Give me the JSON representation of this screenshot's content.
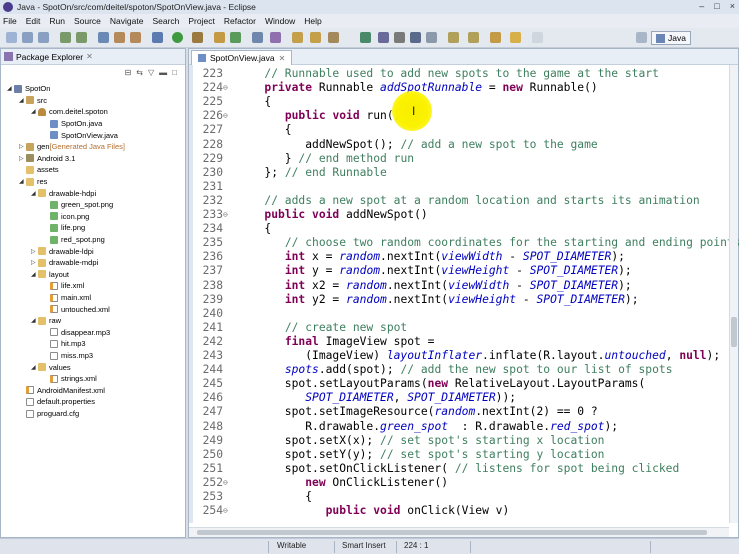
{
  "window": {
    "title": "Java - SpotOn/src/com/deitel/spoton/SpotOnView.java - Eclipse",
    "controls": [
      "–",
      "□",
      "×"
    ]
  },
  "menu": [
    "File",
    "Edit",
    "Run",
    "Source",
    "Navigate",
    "Search",
    "Project",
    "Refactor",
    "Window",
    "Help"
  ],
  "toolbar": {
    "perspective_label": "Java"
  },
  "package_explorer": {
    "title": "Package Explorer",
    "tree": [
      {
        "label": "SpotOn",
        "icon": "project",
        "indent": 1,
        "expanded": true
      },
      {
        "label": "src",
        "icon": "src-folder",
        "indent": 2,
        "expanded": true
      },
      {
        "label": "com.deitel.spoton",
        "icon": "package",
        "indent": 3,
        "expanded": true
      },
      {
        "label": "SpotOn.java",
        "icon": "java-file",
        "indent": 4
      },
      {
        "label": "SpotOnView.java",
        "icon": "java-file",
        "indent": 4
      },
      {
        "label": "gen",
        "extra": "[Generated Java Files]",
        "icon": "src-folder",
        "indent": 2,
        "expanded": false
      },
      {
        "label": "Android 3.1",
        "icon": "library",
        "indent": 2,
        "expanded": false
      },
      {
        "label": "assets",
        "icon": "folder",
        "indent": 2
      },
      {
        "label": "res",
        "icon": "folder",
        "indent": 2,
        "expanded": true
      },
      {
        "label": "drawable-hdpi",
        "icon": "folder",
        "indent": 3,
        "expanded": true
      },
      {
        "label": "green_spot.png",
        "icon": "image-file",
        "indent": 4
      },
      {
        "label": "icon.png",
        "icon": "image-file",
        "indent": 4
      },
      {
        "label": "life.png",
        "icon": "image-file",
        "indent": 4
      },
      {
        "label": "red_spot.png",
        "icon": "image-file",
        "indent": 4
      },
      {
        "label": "drawable-ldpi",
        "icon": "folder",
        "indent": 3,
        "expanded": false
      },
      {
        "label": "drawable-mdpi",
        "icon": "folder",
        "indent": 3,
        "expanded": false
      },
      {
        "label": "layout",
        "icon": "folder",
        "indent": 3,
        "expanded": true
      },
      {
        "label": "life.xml",
        "icon": "xml-file",
        "indent": 4
      },
      {
        "label": "main.xml",
        "icon": "xml-file",
        "indent": 4
      },
      {
        "label": "untouched.xml",
        "icon": "xml-file",
        "indent": 4
      },
      {
        "label": "raw",
        "icon": "folder",
        "indent": 3,
        "expanded": true
      },
      {
        "label": "disappear.mp3",
        "icon": "file",
        "indent": 4
      },
      {
        "label": "hit.mp3",
        "icon": "file",
        "indent": 4
      },
      {
        "label": "miss.mp3",
        "icon": "file",
        "indent": 4
      },
      {
        "label": "values",
        "icon": "folder",
        "indent": 3,
        "expanded": true
      },
      {
        "label": "strings.xml",
        "icon": "xml-file",
        "indent": 4
      },
      {
        "label": "AndroidManifest.xml",
        "icon": "xml-file",
        "indent": 2
      },
      {
        "label": "default.properties",
        "icon": "file",
        "indent": 2
      },
      {
        "label": "proguard.cfg",
        "icon": "file",
        "indent": 2
      }
    ]
  },
  "editor": {
    "tab_label": "SpotOnView.java",
    "lines": [
      {
        "n": "223",
        "fold": "",
        "tokens": [
          [
            "   ",
            ""
          ],
          [
            "// Runnable used to add new spots to the game at the start",
            "cm"
          ]
        ]
      },
      {
        "n": "224",
        "fold": "⊖",
        "tokens": [
          [
            "   ",
            ""
          ],
          [
            "private",
            "kw"
          ],
          [
            " Runnable ",
            ""
          ],
          [
            "addSpotRunnable",
            "fld"
          ],
          [
            " = ",
            ""
          ],
          [
            "new",
            "kw"
          ],
          [
            " Runnable()",
            ""
          ]
        ]
      },
      {
        "n": "225",
        "fold": "",
        "tokens": [
          [
            "   {",
            ""
          ]
        ]
      },
      {
        "n": "226",
        "fold": "⊖",
        "tokens": [
          [
            "      ",
            ""
          ],
          [
            "public",
            "kw"
          ],
          [
            " ",
            ""
          ],
          [
            "void",
            "kw"
          ],
          [
            " run()",
            ""
          ]
        ]
      },
      {
        "n": "227",
        "fold": "",
        "tokens": [
          [
            "      {",
            ""
          ]
        ]
      },
      {
        "n": "228",
        "fold": "",
        "tokens": [
          [
            "         addNewSpot(); ",
            ""
          ],
          [
            "// add a new spot to the game",
            "cm"
          ]
        ]
      },
      {
        "n": "229",
        "fold": "",
        "tokens": [
          [
            "      } ",
            ""
          ],
          [
            "// end method run",
            "cm"
          ]
        ]
      },
      {
        "n": "230",
        "fold": "",
        "tokens": [
          [
            "   }; ",
            ""
          ],
          [
            "// end Runnable",
            "cm"
          ]
        ]
      },
      {
        "n": "231",
        "fold": "",
        "tokens": [
          [
            "",
            ""
          ]
        ]
      },
      {
        "n": "232",
        "fold": "",
        "tokens": [
          [
            "   ",
            ""
          ],
          [
            "// adds a new spot at a random location and starts its animation",
            "cm"
          ]
        ]
      },
      {
        "n": "233",
        "fold": "⊖",
        "tokens": [
          [
            "   ",
            ""
          ],
          [
            "public",
            "kw"
          ],
          [
            " ",
            ""
          ],
          [
            "void",
            "kw"
          ],
          [
            " addNewSpot()",
            ""
          ]
        ]
      },
      {
        "n": "234",
        "fold": "",
        "tokens": [
          [
            "   {",
            ""
          ]
        ]
      },
      {
        "n": "235",
        "fold": "",
        "tokens": [
          [
            "      ",
            ""
          ],
          [
            "// choose two random coordinates for the starting and ending points",
            "cm"
          ]
        ]
      },
      {
        "n": "236",
        "fold": "",
        "tokens": [
          [
            "      ",
            ""
          ],
          [
            "int",
            "kw"
          ],
          [
            " x = ",
            ""
          ],
          [
            "random",
            "fld"
          ],
          [
            ".nextInt(",
            ""
          ],
          [
            "viewWidth",
            "fld"
          ],
          [
            " - ",
            ""
          ],
          [
            "SPOT_DIAMETER",
            "sfld"
          ],
          [
            ");",
            ""
          ]
        ]
      },
      {
        "n": "237",
        "fold": "",
        "tokens": [
          [
            "      ",
            ""
          ],
          [
            "int",
            "kw"
          ],
          [
            " y = ",
            ""
          ],
          [
            "random",
            "fld"
          ],
          [
            ".nextInt(",
            ""
          ],
          [
            "viewHeight",
            "fld"
          ],
          [
            " - ",
            ""
          ],
          [
            "SPOT_DIAMETER",
            "sfld"
          ],
          [
            ");",
            ""
          ]
        ]
      },
      {
        "n": "238",
        "fold": "",
        "tokens": [
          [
            "      ",
            ""
          ],
          [
            "int",
            "kw"
          ],
          [
            " x2 = ",
            ""
          ],
          [
            "random",
            "fld"
          ],
          [
            ".nextInt(",
            ""
          ],
          [
            "viewWidth",
            "fld"
          ],
          [
            " - ",
            ""
          ],
          [
            "SPOT_DIAMETER",
            "sfld"
          ],
          [
            ");",
            ""
          ]
        ]
      },
      {
        "n": "239",
        "fold": "",
        "tokens": [
          [
            "      ",
            ""
          ],
          [
            "int",
            "kw"
          ],
          [
            " y2 = ",
            ""
          ],
          [
            "random",
            "fld"
          ],
          [
            ".nextInt(",
            ""
          ],
          [
            "viewHeight",
            "fld"
          ],
          [
            " - ",
            ""
          ],
          [
            "SPOT_DIAMETER",
            "sfld"
          ],
          [
            ");",
            ""
          ]
        ]
      },
      {
        "n": "240",
        "fold": "",
        "tokens": [
          [
            "",
            ""
          ]
        ]
      },
      {
        "n": "241",
        "fold": "",
        "tokens": [
          [
            "      ",
            ""
          ],
          [
            "// create new spot",
            "cm"
          ]
        ]
      },
      {
        "n": "242",
        "fold": "",
        "tokens": [
          [
            "      ",
            ""
          ],
          [
            "final",
            "kw"
          ],
          [
            " ImageView spot =",
            ""
          ]
        ]
      },
      {
        "n": "243",
        "fold": "",
        "tokens": [
          [
            "         (ImageView) ",
            ""
          ],
          [
            "layoutInflater",
            "fld"
          ],
          [
            ".inflate(R.layout.",
            ""
          ],
          [
            "untouched",
            "sfld"
          ],
          [
            ", ",
            ""
          ],
          [
            "null",
            "kw"
          ],
          [
            ");",
            ""
          ]
        ]
      },
      {
        "n": "244",
        "fold": "",
        "tokens": [
          [
            "      ",
            ""
          ],
          [
            "spots",
            "fld"
          ],
          [
            ".add(spot); ",
            ""
          ],
          [
            "// add the new spot to our list of spots",
            "cm"
          ]
        ]
      },
      {
        "n": "245",
        "fold": "",
        "tokens": [
          [
            "      spot.setLayoutParams(",
            ""
          ],
          [
            "new",
            "kw"
          ],
          [
            " RelativeLayout.LayoutParams(",
            ""
          ]
        ]
      },
      {
        "n": "246",
        "fold": "",
        "tokens": [
          [
            "         ",
            ""
          ],
          [
            "SPOT_DIAMETER",
            "sfld"
          ],
          [
            ", ",
            ""
          ],
          [
            "SPOT_DIAMETER",
            "sfld"
          ],
          [
            "));",
            ""
          ]
        ]
      },
      {
        "n": "247",
        "fold": "",
        "tokens": [
          [
            "      spot.setImageResource(",
            ""
          ],
          [
            "random",
            "fld"
          ],
          [
            ".nextInt(2) == 0 ?",
            ""
          ]
        ]
      },
      {
        "n": "248",
        "fold": "",
        "tokens": [
          [
            "         R.drawable.",
            ""
          ],
          [
            "green_spot",
            "sfld"
          ],
          [
            "  : R.drawable.",
            ""
          ],
          [
            "red_spot",
            "sfld"
          ],
          [
            ");",
            ""
          ]
        ]
      },
      {
        "n": "249",
        "fold": "",
        "tokens": [
          [
            "      spot.setX(x); ",
            ""
          ],
          [
            "// set spot's starting x location",
            "cm"
          ]
        ]
      },
      {
        "n": "250",
        "fold": "",
        "tokens": [
          [
            "      spot.setY(y); ",
            ""
          ],
          [
            "// set spot's starting y location",
            "cm"
          ]
        ]
      },
      {
        "n": "251",
        "fold": "",
        "tokens": [
          [
            "      spot.setOnClickListener( ",
            ""
          ],
          [
            "// listens for spot being clicked",
            "cm"
          ]
        ]
      },
      {
        "n": "252",
        "fold": "⊖",
        "tokens": [
          [
            "         ",
            ""
          ],
          [
            "new",
            "kw"
          ],
          [
            " OnClickListener()",
            ""
          ]
        ]
      },
      {
        "n": "253",
        "fold": "",
        "tokens": [
          [
            "         {",
            ""
          ]
        ]
      },
      {
        "n": "254",
        "fold": "⊖",
        "tokens": [
          [
            "            ",
            ""
          ],
          [
            "public",
            "kw"
          ],
          [
            " ",
            ""
          ],
          [
            "void",
            "kw"
          ],
          [
            " onClick(View v)",
            ""
          ]
        ]
      }
    ]
  },
  "status": {
    "writable": "Writable",
    "insert_mode": "Smart Insert",
    "position": "224 : 1"
  }
}
